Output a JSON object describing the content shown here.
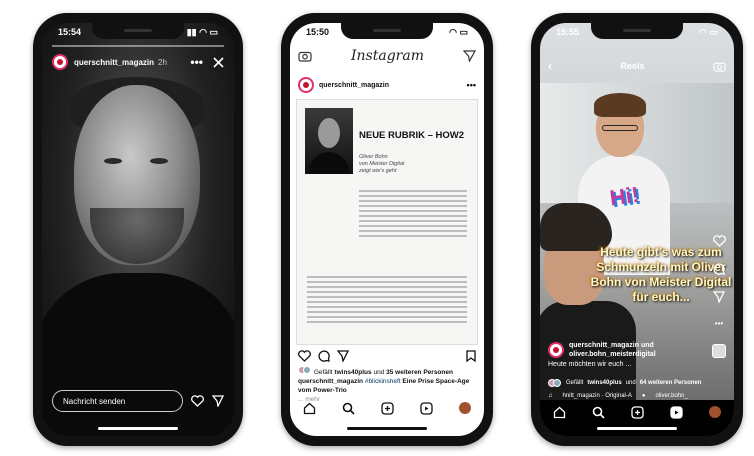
{
  "story": {
    "time": "15:54",
    "account": "querschnitt_magazin",
    "age": "2h",
    "reply_placeholder": "Nachricht senden"
  },
  "feed": {
    "time": "15:50",
    "app_name": "Instagram",
    "account": "querschnitt_magazin",
    "post": {
      "headline": "NEUE RUBRIK – HOW2",
      "sub_lines": [
        "Oliver Bohn",
        "von Meister Digital",
        "zeigt wie’s geht"
      ]
    },
    "liked_prefix": "Gefällt",
    "liked_user": "twins40plus",
    "liked_mid": "und",
    "liked_count": "35 weiteren Personen",
    "caption_user": "querschnitt_magazin",
    "caption_tag": "#blickinsheft",
    "caption_text": "Eine Prise Space-Age vom Power-Trio",
    "more": "... mehr"
  },
  "reel": {
    "time": "15:55",
    "header": "Reels",
    "caption_overlay": "Heute gibt’s was zum Schmunzeln mit Oliver Bohn von Meister Digital für euch...",
    "sticker": "Hi!",
    "user_line1": "querschnitt_magazin und",
    "user_line2": "oliver.bohn_meisterdigital",
    "description": "Heute möchten wir euch ...",
    "liked_prefix": "Gefällt",
    "liked_user": "twins40plus",
    "liked_mid": "und",
    "liked_count": "64 weiteren Personen",
    "audio": "hnitt_magazin · Original-A",
    "tagged": "oliver.bohn_"
  }
}
